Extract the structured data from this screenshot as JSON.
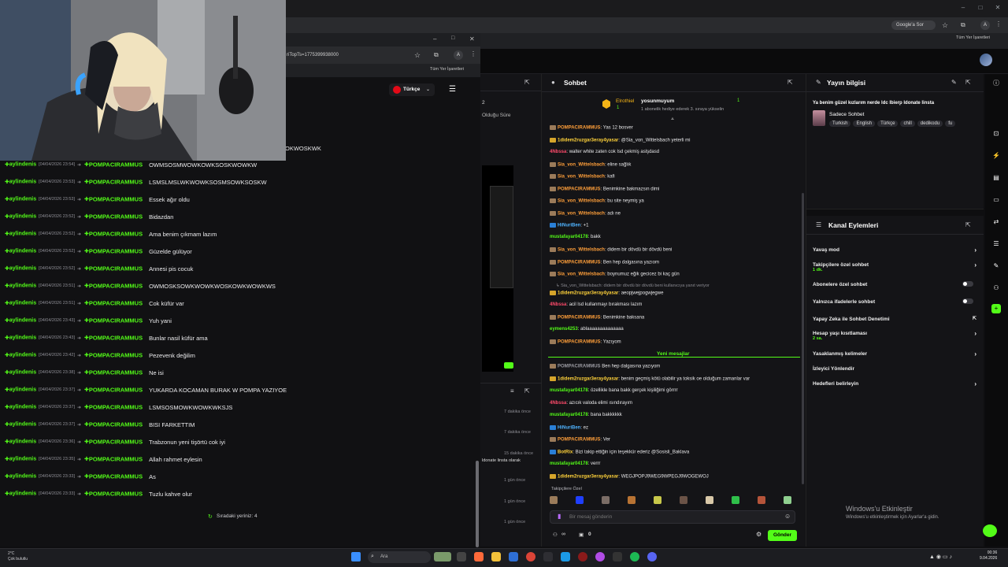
{
  "back_browser": {
    "google_sor": "Google'a Sor",
    "bookmarks_label": "Tüm Yer İşaretleri"
  },
  "front_browser": {
    "url": "riTopTs=1775399938000",
    "bookmarks_label": "Tüm Yer İşaretleri",
    "language": "Türkçe",
    "partial_header": "OKWOSKWK"
  },
  "chat_log": {
    "sender": "aylindenis",
    "target": "POMPACIRAMMUS",
    "rows": [
      {
        "time": "[04/04/2026 23:54]",
        "msg": "OWMSOSMWOWKOWKSOSKWOWKW"
      },
      {
        "time": "[04/04/2026 23:53]",
        "msg": "LSMSLMSLWKWOWKSOSMSOWKSOSKW"
      },
      {
        "time": "[04/04/2026 23:53]",
        "msg": "Essek ağır oldu"
      },
      {
        "time": "[04/04/2026 23:52]",
        "msg": "Bidazdan"
      },
      {
        "time": "[04/04/2026 23:52]",
        "msg": "Ama benim çıkmam lazım"
      },
      {
        "time": "[04/04/2026 23:52]",
        "msg": "Güzelde gülüyor"
      },
      {
        "time": "[04/04/2026 23:52]",
        "msg": "Annesi pis cocuk"
      },
      {
        "time": "[04/04/2026 23:51]",
        "msg": "OWMOSKSOWKWOWKWOSKOWKWOWKWS"
      },
      {
        "time": "[04/04/2026 23:51]",
        "msg": "Cok küfür var"
      },
      {
        "time": "[04/04/2026 23:43]",
        "msg": "Yuh yani"
      },
      {
        "time": "[04/04/2026 23:43]",
        "msg": "Bunlar nasil küfür ama"
      },
      {
        "time": "[04/04/2026 23:42]",
        "msg": "Pezevenk değilim"
      },
      {
        "time": "[04/04/2026 23:38]",
        "msg": "Ne isi"
      },
      {
        "time": "[04/04/2026 23:37]",
        "msg": "YUKARDA KOCAMAN BURAK W POMPA YAZIYOE"
      },
      {
        "time": "[04/04/2026 23:37]",
        "msg": "LSMSOSMOWKWOWKWKSJS"
      },
      {
        "time": "[04/04/2026 23:37]",
        "msg": "BISI FARKETTIM"
      },
      {
        "time": "[04/04/2026 23:36]",
        "msg": "Trabzonun yeni tişörtü cok iyi"
      },
      {
        "time": "[04/04/2026 23:35]",
        "msg": "Allah rahmet eylesin"
      },
      {
        "time": "[04/04/2026 23:33]",
        "msg": "As"
      },
      {
        "time": "[04/04/2026 23:33]",
        "msg": "Tuzlu kahve olur"
      }
    ],
    "queue": "Sıradaki yeriniz: 4"
  },
  "left_panel": {
    "number": "2",
    "olduğu_sure": "Olduğu Süre",
    "times": [
      "7 dakika önce",
      "7 dakika önce",
      "15 dakika önce",
      "1 gün önce",
      "1 gün önce",
      "1 gün önce"
    ],
    "activity": "ldonate linsta olarak"
  },
  "chat": {
    "title": "Sohbet",
    "top_user": "Elrothiel",
    "top_user_count": "1",
    "second_user": "yosunmuyum",
    "second_user_count": "1",
    "gift_note": "1 abonelik hediye ederek 3. sıraya yükselin",
    "messages": [
      {
        "user": "POMPACIRAMMUS",
        "color": "#ff9f3a",
        "text": ": Yas 12 bosver"
      },
      {
        "user": "1didem2ruzgar3eray4yasar",
        "color": "#ffd23a",
        "text": ": @Sia_von_Wittelsbach yeterli mi"
      },
      {
        "user": "4Nbssa",
        "color": "#ff4b6b",
        "text": ": walter white zaten cok Isd çekmiş aslşdasd"
      },
      {
        "user": "Sia_von_Wittelsbach",
        "color": "#ff9f3a",
        "text": ": eline sağlık"
      },
      {
        "user": "Sia_von_Wittelsbach",
        "color": "#ff9f3a",
        "text": ": kafi"
      },
      {
        "user": "POMPACIRAMMUS",
        "color": "#ff9f3a",
        "text": ": Benimkine bakmazsın dimi"
      },
      {
        "user": "Sia_von_Wittelsbach",
        "color": "#ff9f3a",
        "text": ": bu site neymiş ya"
      },
      {
        "user": "Sia_von_Wittelsbach",
        "color": "#ff9f3a",
        "text": ": adı ne"
      },
      {
        "user": "HiNuriBen",
        "color": "#4fb3ff",
        "text": ": +1"
      },
      {
        "user": "mustafayar04178",
        "color": "#53fc18",
        "text": ": bakk"
      },
      {
        "user": "Sia_von_Wittelsbach",
        "color": "#ff9f3a",
        "text": ": didem bir dövdü bir dövdü beni"
      },
      {
        "user": "POMPACIRAMMUS",
        "color": "#ff9f3a",
        "text": ": Ben hep dalgasına yazıom"
      },
      {
        "user": "Sia_von_Wittelsbach",
        "color": "#ff9f3a",
        "text": ": boynumuz eğik gecicez bi kaç gün"
      },
      {
        "user": "1didem2ruzgar3eray4yasar",
        "color": "#ffd23a",
        "text": ": aeopjwejpogwjegwe"
      },
      {
        "user": "4Nbssa",
        "color": "#ff4b6b",
        "text": ": acil lsd kullanmayı bırakması lazım"
      },
      {
        "user": "POMPACIRAMMUS",
        "color": "#ff9f3a",
        "text": ": Benimkine baksana"
      },
      {
        "user": "eymens4253",
        "color": "#53fc18",
        "text": ": ablaaaaaaaaaaaaaa"
      },
      {
        "user": "POMPACIRAMMUS",
        "color": "#ff9f3a",
        "text": ": Yazıyom"
      }
    ],
    "reply_note": "↳ Sia_von_Wittelsbach: didem bir dövdü bir dövdü beni kullanıcıya yanıt veriyor",
    "new_messages_label": "Yeni mesajlar",
    "new_messages": [
      {
        "user": "POMPACIRAMMUS",
        "color": "#9b9ba2",
        "text": " Ben hep dalgasına yazıyom"
      },
      {
        "user": "1didem2ruzgar3eray4yasar",
        "color": "#ffd23a",
        "text": ": benim geçmiş kötü olabilir ya toksik oe olduğum zamanlar var"
      },
      {
        "user": "mustafayar04178",
        "color": "#53fc18",
        "text": ": özellikle bana bakk gerçek kişiliğimi görrrr"
      },
      {
        "user": "4Nbssa",
        "color": "#ff4b6b",
        "text": ": azıcık valoda elimi ısındırayım"
      },
      {
        "user": "mustafayar04178",
        "color": "#53fc18",
        "text": ": bana bakkkkkk"
      },
      {
        "user": "HiNuriBen",
        "color": "#4fb3ff",
        "text": ": ez"
      },
      {
        "user": "POMPACIRAMMUS",
        "color": "#ff9f3a",
        "text": ": Ver"
      },
      {
        "user": "BotRix",
        "color": "#ffd23a",
        "text": ": Bizi takip ettiğin için teşekkür ederiz @Sosisli_Baklava"
      },
      {
        "user": "mustafayar04178",
        "color": "#53fc18",
        "text": ": verrr"
      },
      {
        "user": "1didem2ruzgar3eray4yasar",
        "color": "#ffd23a",
        "text": ": WEGJPOPJ9WEG9WPEGJ9WOGEWOJ"
      }
    ],
    "followers_only": "Takipçilere Özel",
    "input_placeholder": "Bir mesaj gönderin",
    "viewer_count": "∞",
    "count_zero": "0",
    "send_label": "Gönder"
  },
  "stream_info": {
    "title": "Yayın bilgisi",
    "stream_title": "Ya benim güzel kızlarım nerde ldc lbierp ldonate linsta",
    "category": "Sadece Sohbet",
    "tags": [
      "Turkish",
      "English",
      "Türkçe",
      "chill",
      "dedikodu",
      "fu"
    ]
  },
  "channel_actions": {
    "title": "Kanal Eylemleri",
    "items": [
      {
        "label": "Yavaş mod",
        "sub": "",
        "control": "chevron"
      },
      {
        "label": "Takipçilere özel sohbet",
        "sub": "1 dk.",
        "control": "chevron"
      },
      {
        "label": "Abonelere özel sohbet",
        "sub": "",
        "control": "toggle"
      },
      {
        "label": "Yalnızca ifadelerle sohbet",
        "sub": "",
        "control": "toggle"
      },
      {
        "label": "Yapay Zeka ile Sohbet Denetimi",
        "sub": "",
        "control": "external"
      },
      {
        "label": "Hesap yaşı kısıtlaması",
        "sub": "2 sa.",
        "control": "chevron"
      },
      {
        "label": "Yasaklanmış kelimeler",
        "sub": "",
        "control": "chevron"
      },
      {
        "label": "İzleyici Yönlendir",
        "sub": "",
        "control": "none"
      },
      {
        "label": "Hedefleri belirleyin",
        "sub": "",
        "control": "chevron"
      }
    ]
  },
  "windows_watermark": {
    "title": "Windows'u Etkinleştir",
    "subtitle": "Windows'u etkinleştirmek için Ayarlar'a gidin."
  },
  "taskbar": {
    "weather_temp": "2°C",
    "weather_desc": "Çok bulutlu",
    "search_placeholder": "Ara",
    "time": "00:36",
    "date": "9.04.2026"
  }
}
